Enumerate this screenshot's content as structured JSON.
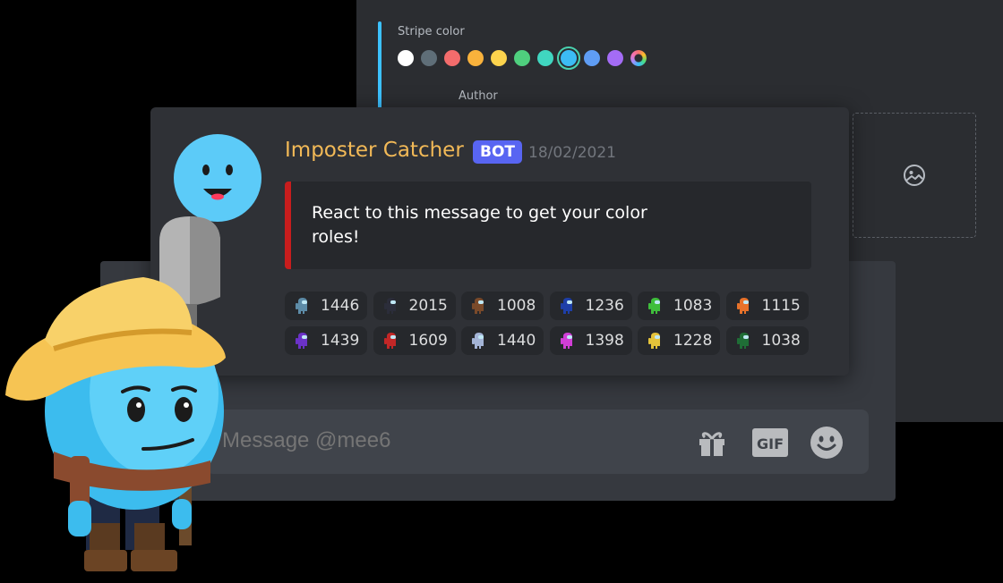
{
  "embed_builder": {
    "stripe_color_label": "Stripe color",
    "author_label": "Author",
    "swatch_colors": [
      "#ffffff",
      "#5f6e78",
      "#f36c6c",
      "#f9b23c",
      "#fcd34d",
      "#4fcf7e",
      "#40d6c0",
      "#3cbcf4",
      "#5f9df4",
      "#a46cf5"
    ],
    "selected_swatch": "#3cbcf4",
    "image_placeholder_icon": "image-icon"
  },
  "message": {
    "username": "Imposter Catcher",
    "badge": "BOT",
    "timestamp": "18/02/2021",
    "embed_text": "React to this message to get your color roles!",
    "embed_color": "#c81d1d",
    "username_color": "#f2b957",
    "reactions": [
      {
        "color": "#5d8ca8",
        "count": "1446"
      },
      {
        "color": "#2b2d3a",
        "count": "2015"
      },
      {
        "color": "#7a4a2a",
        "count": "1008"
      },
      {
        "color": "#1e3fa8",
        "count": "1236"
      },
      {
        "color": "#3fbe3c",
        "count": "1083"
      },
      {
        "color": "#e8722a",
        "count": "1115"
      },
      {
        "color": "#6b32c8",
        "count": "1439"
      },
      {
        "color": "#c22727",
        "count": "1609"
      },
      {
        "color": "#a4b4d6",
        "count": "1440"
      },
      {
        "color": "#d13ed6",
        "count": "1398"
      },
      {
        "color": "#e4c23a",
        "count": "1228"
      },
      {
        "color": "#1f6e36",
        "count": "1038"
      }
    ]
  },
  "chat_input": {
    "placeholder": "Message @mee6",
    "icons": [
      "gift-icon",
      "gif-icon",
      "emoji-icon"
    ],
    "gif_label": "GIF"
  }
}
